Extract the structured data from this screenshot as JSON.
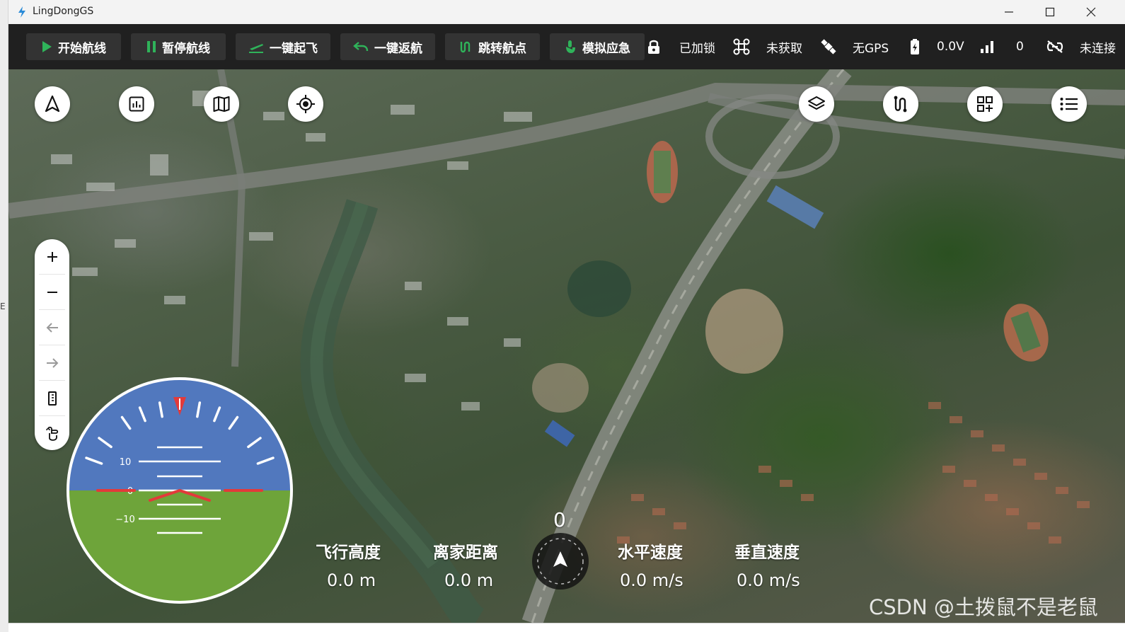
{
  "desktop": {
    "edge_text": "E"
  },
  "window": {
    "title": "LingDongGS",
    "controls": {
      "minimize": "minimize-icon",
      "maximize": "maximize-icon",
      "close": "close-icon"
    }
  },
  "toolbar": {
    "buttons": [
      {
        "label": "开始航线",
        "icon": "play-icon"
      },
      {
        "label": "暂停航线",
        "icon": "pause-icon"
      },
      {
        "label": "一键起飞",
        "icon": "takeoff-icon"
      },
      {
        "label": "一键返航",
        "icon": "return-icon"
      },
      {
        "label": "跳转航点",
        "icon": "route-icon"
      },
      {
        "label": "模拟应急",
        "icon": "emergency-icon"
      }
    ],
    "status": {
      "lock": "已加锁",
      "mode": "未获取",
      "gps": "无GPS",
      "voltage": "0.0V",
      "signal": "0",
      "link": "未连接"
    }
  },
  "map": {
    "top_buttons": [
      "navigation-icon",
      "chart-icon",
      "map-icon",
      "locate-icon",
      "layers-icon",
      "route-icon",
      "grid-add-icon",
      "list-icon"
    ],
    "zoom_panel": [
      "plus-icon",
      "minus-icon",
      "arrow-left-icon",
      "arrow-right-icon",
      "ruler-icon",
      "hand-icon"
    ],
    "attitude": {
      "pitch_labels": [
        "10",
        "0",
        "−10"
      ],
      "pitch": 0,
      "roll": 0
    },
    "heading": "0",
    "stats": [
      {
        "label": "飞行高度",
        "value": "0.0 m"
      },
      {
        "label": "离家距离",
        "value": "0.0 m"
      },
      {
        "label": "水平速度",
        "value": "0.0 m/s"
      },
      {
        "label": "垂直速度",
        "value": "0.0 m/s"
      }
    ],
    "watermark": "CSDN @土拨鼠不是老鼠"
  },
  "colors": {
    "toolbar_bg": "#202020",
    "button_bg": "#333333",
    "accent_green": "#2fb35a",
    "sky": "#5178be",
    "ground": "#6ea43a",
    "attitude_red": "#e23a3a"
  }
}
